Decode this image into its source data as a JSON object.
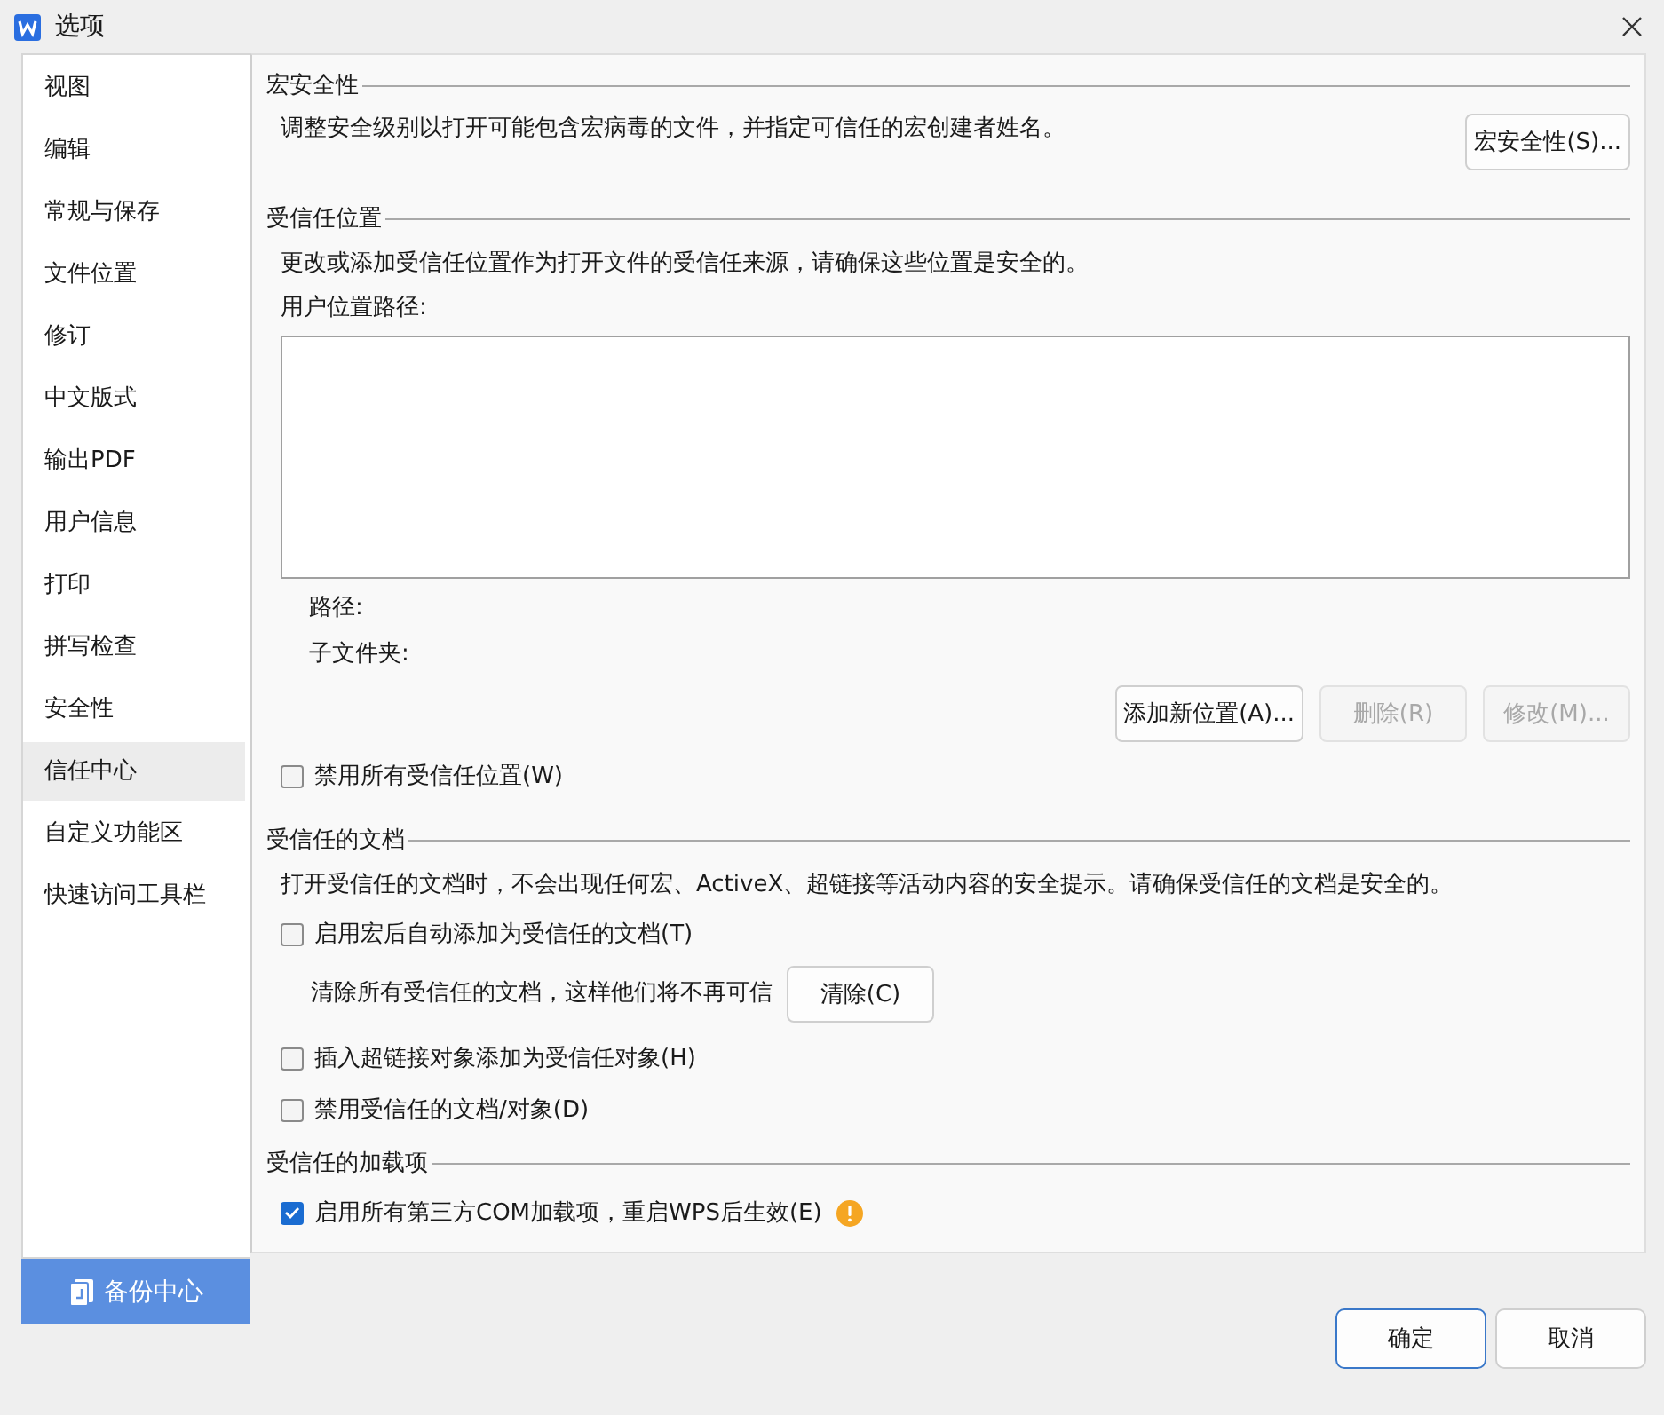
{
  "window": {
    "title": "选项"
  },
  "sidebar": {
    "items": [
      {
        "label": "视图",
        "selected": false
      },
      {
        "label": "编辑",
        "selected": false
      },
      {
        "label": "常规与保存",
        "selected": false
      },
      {
        "label": "文件位置",
        "selected": false
      },
      {
        "label": "修订",
        "selected": false
      },
      {
        "label": "中文版式",
        "selected": false
      },
      {
        "label": "输出PDF",
        "selected": false
      },
      {
        "label": "用户信息",
        "selected": false
      },
      {
        "label": "打印",
        "selected": false
      },
      {
        "label": "拼写检查",
        "selected": false
      },
      {
        "label": "安全性",
        "selected": false
      },
      {
        "label": "信任中心",
        "selected": true
      },
      {
        "label": "自定义功能区",
        "selected": false
      },
      {
        "label": "快速访问工具栏",
        "selected": false
      }
    ],
    "footer_button": "备份中心"
  },
  "sections": [
    {
      "title": "宏安全性",
      "items": [
        {
          "kind": "text-button",
          "text": "调整安全级别以打开可能包含宏病毒的文件，并指定可信任的宏创建者姓名。",
          "button": {
            "label": "宏安全性(S)...",
            "disabled": false
          }
        }
      ]
    },
    {
      "title": "受信任位置",
      "items": [
        {
          "kind": "text",
          "text": "更改或添加受信任位置作为打开文件的受信任来源，请确保这些位置是安全的。"
        },
        {
          "kind": "label",
          "text": "用户位置路径:"
        },
        {
          "kind": "listbox"
        },
        {
          "kind": "detail",
          "text": "路径:"
        },
        {
          "kind": "detail",
          "text": "子文件夹:"
        },
        {
          "kind": "buttons",
          "buttons": [
            {
              "label": "添加新位置(A)...",
              "disabled": false
            },
            {
              "label": "删除(R)",
              "disabled": true
            },
            {
              "label": "修改(M)...",
              "disabled": true
            }
          ]
        },
        {
          "kind": "checkbox",
          "label": "禁用所有受信任位置(W)",
          "checked": false,
          "warning": false
        }
      ]
    },
    {
      "title": "受信任的文档",
      "items": [
        {
          "kind": "text",
          "text": "打开受信任的文档时，不会出现任何宏、ActiveX、超链接等活动内容的安全提示。请确保受信任的文档是安全的。"
        },
        {
          "kind": "checkbox",
          "label": "启用宏后自动添加为受信任的文档(T)",
          "checked": false,
          "warning": false
        },
        {
          "kind": "detail-button",
          "text": "清除所有受信任的文档，这样他们将不再可信",
          "button": {
            "label": "清除(C)",
            "disabled": false
          }
        },
        {
          "kind": "checkbox",
          "label": "插入超链接对象添加为受信任对象(H)",
          "checked": false,
          "warning": false
        },
        {
          "kind": "checkbox",
          "label": "禁用受信任的文档/对象(D)",
          "checked": false,
          "warning": false
        }
      ]
    },
    {
      "title": "受信任的加载项",
      "items": [
        {
          "kind": "checkbox",
          "label": "启用所有第三方COM加载项，重启WPS后生效(E)",
          "checked": true,
          "warning": true
        }
      ]
    }
  ],
  "footer": {
    "buttons": [
      {
        "label": "确定",
        "default": true
      },
      {
        "label": "取消",
        "default": false
      }
    ]
  }
}
